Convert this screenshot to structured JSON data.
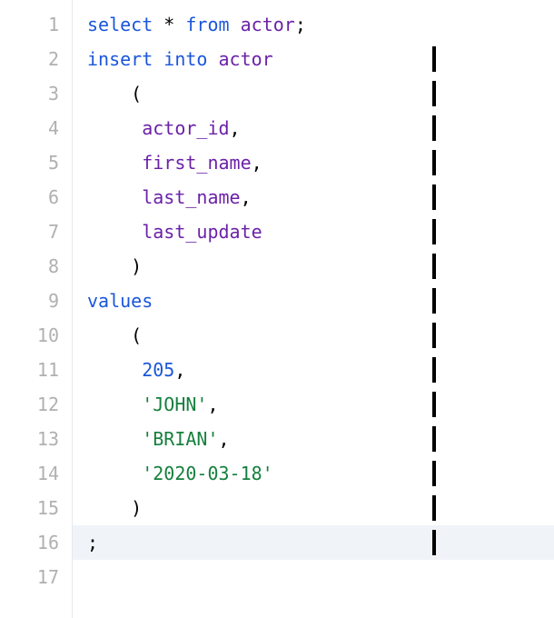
{
  "editor": {
    "lines": [
      {
        "num": "1",
        "tokens": [
          {
            "cls": "kw",
            "text": "select"
          },
          {
            "cls": "plain",
            "text": " "
          },
          {
            "cls": "star",
            "text": "*"
          },
          {
            "cls": "plain",
            "text": " "
          },
          {
            "cls": "kw",
            "text": "from"
          },
          {
            "cls": "plain",
            "text": " "
          },
          {
            "cls": "ident",
            "text": "actor"
          },
          {
            "cls": "punct",
            "text": ";"
          }
        ],
        "cursor": false,
        "highlighted": false
      },
      {
        "num": "2",
        "tokens": [
          {
            "cls": "kw",
            "text": "insert"
          },
          {
            "cls": "plain",
            "text": " "
          },
          {
            "cls": "kw",
            "text": "into"
          },
          {
            "cls": "plain",
            "text": " "
          },
          {
            "cls": "ident",
            "text": "actor"
          }
        ],
        "cursor": true,
        "highlighted": false
      },
      {
        "num": "3",
        "tokens": [
          {
            "cls": "plain",
            "text": "    "
          },
          {
            "cls": "punct",
            "text": "("
          }
        ],
        "cursor": true,
        "highlighted": false
      },
      {
        "num": "4",
        "tokens": [
          {
            "cls": "plain",
            "text": "     "
          },
          {
            "cls": "ident",
            "text": "actor_id"
          },
          {
            "cls": "punct",
            "text": ","
          }
        ],
        "cursor": true,
        "highlighted": false
      },
      {
        "num": "5",
        "tokens": [
          {
            "cls": "plain",
            "text": "     "
          },
          {
            "cls": "ident",
            "text": "first_name"
          },
          {
            "cls": "punct",
            "text": ","
          }
        ],
        "cursor": true,
        "highlighted": false
      },
      {
        "num": "6",
        "tokens": [
          {
            "cls": "plain",
            "text": "     "
          },
          {
            "cls": "ident",
            "text": "last_name"
          },
          {
            "cls": "punct",
            "text": ","
          }
        ],
        "cursor": true,
        "highlighted": false
      },
      {
        "num": "7",
        "tokens": [
          {
            "cls": "plain",
            "text": "     "
          },
          {
            "cls": "ident",
            "text": "last_update"
          }
        ],
        "cursor": true,
        "highlighted": false
      },
      {
        "num": "8",
        "tokens": [
          {
            "cls": "plain",
            "text": "    "
          },
          {
            "cls": "punct",
            "text": ")"
          }
        ],
        "cursor": true,
        "highlighted": false
      },
      {
        "num": "9",
        "tokens": [
          {
            "cls": "kw",
            "text": "values"
          }
        ],
        "cursor": true,
        "highlighted": false
      },
      {
        "num": "10",
        "tokens": [
          {
            "cls": "plain",
            "text": "    "
          },
          {
            "cls": "punct",
            "text": "("
          }
        ],
        "cursor": true,
        "highlighted": false
      },
      {
        "num": "11",
        "tokens": [
          {
            "cls": "plain",
            "text": "     "
          },
          {
            "cls": "num",
            "text": "205"
          },
          {
            "cls": "punct",
            "text": ","
          }
        ],
        "cursor": true,
        "highlighted": false
      },
      {
        "num": "12",
        "tokens": [
          {
            "cls": "plain",
            "text": "     "
          },
          {
            "cls": "str",
            "text": "'JOHN'"
          },
          {
            "cls": "punct",
            "text": ","
          }
        ],
        "cursor": true,
        "highlighted": false
      },
      {
        "num": "13",
        "tokens": [
          {
            "cls": "plain",
            "text": "     "
          },
          {
            "cls": "str",
            "text": "'BRIAN'"
          },
          {
            "cls": "punct",
            "text": ","
          }
        ],
        "cursor": true,
        "highlighted": false
      },
      {
        "num": "14",
        "tokens": [
          {
            "cls": "plain",
            "text": "     "
          },
          {
            "cls": "str",
            "text": "'2020-03-18'"
          }
        ],
        "cursor": true,
        "highlighted": false
      },
      {
        "num": "15",
        "tokens": [
          {
            "cls": "plain",
            "text": "    "
          },
          {
            "cls": "punct",
            "text": ")"
          }
        ],
        "cursor": true,
        "highlighted": false
      },
      {
        "num": "16",
        "tokens": [
          {
            "cls": "punct",
            "text": ";"
          }
        ],
        "cursor": true,
        "highlighted": true
      },
      {
        "num": "17",
        "tokens": [],
        "cursor": false,
        "highlighted": false
      }
    ]
  }
}
